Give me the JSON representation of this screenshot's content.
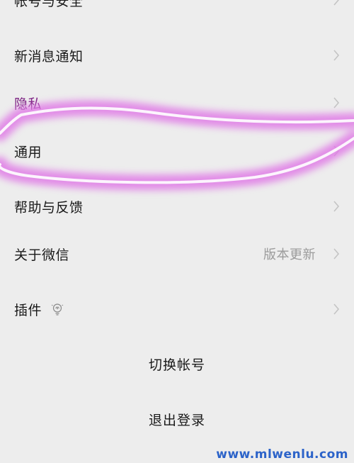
{
  "settings": {
    "items": [
      {
        "label": "帐号与安全",
        "value": ""
      },
      {
        "label": "新消息通知",
        "value": ""
      },
      {
        "label": "隐私",
        "value": ""
      },
      {
        "label": "通用",
        "value": ""
      },
      {
        "label": "帮助与反馈",
        "value": ""
      },
      {
        "label": "关于微信",
        "value": "版本更新"
      },
      {
        "label": "插件",
        "value": ""
      }
    ],
    "switch_account": "切换帐号",
    "logout": "退出登录"
  },
  "watermark": "www.mlwenlu.com",
  "colors": {
    "background": "#ededed",
    "text": "#1a1a1a",
    "secondary_text": "#9b9b9b",
    "chevron": "#c4c4c4",
    "highlight_stroke": "#e07be6",
    "watermark": "#2c63c9"
  },
  "icons": {
    "plugin_hint": "lightbulb-icon",
    "row_arrow": "chevron-right-icon"
  }
}
